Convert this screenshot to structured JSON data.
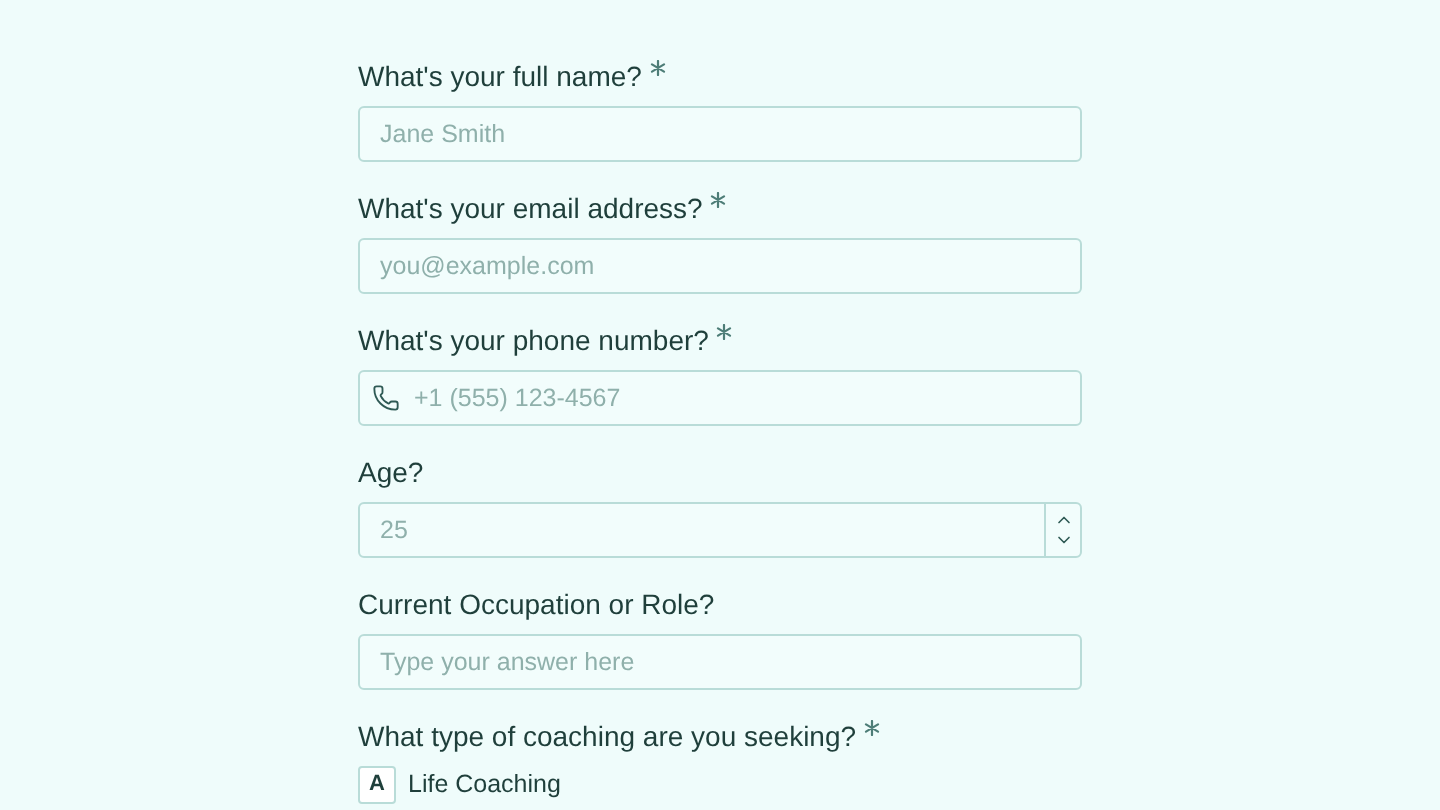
{
  "questions": [
    {
      "kind": "text",
      "label": "What's your full name?",
      "required": true,
      "placeholder": "Jane Smith"
    },
    {
      "kind": "text",
      "label": "What's your email address?",
      "required": true,
      "placeholder": "you@example.com"
    },
    {
      "kind": "phone",
      "label": "What's your phone number?",
      "required": true,
      "placeholder": "+1 (555) 123-4567"
    },
    {
      "kind": "number",
      "label": "Age?",
      "required": false,
      "placeholder": "25"
    },
    {
      "kind": "text",
      "label": "Current Occupation or Role?",
      "required": false,
      "placeholder": "Type your answer here"
    },
    {
      "kind": "choice",
      "label": "What type of coaching are you seeking?",
      "required": true,
      "options": [
        {
          "key": "A",
          "label": "Life Coaching"
        }
      ]
    }
  ]
}
